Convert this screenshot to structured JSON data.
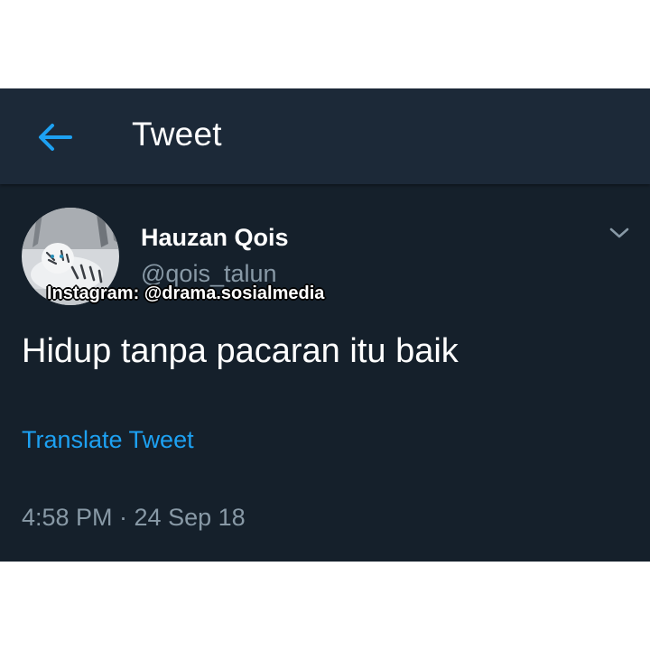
{
  "header": {
    "title": "Tweet",
    "back_icon": "arrow-left-icon"
  },
  "tweet": {
    "author_name": "Hauzan Qois",
    "author_handle": "@qois_talun",
    "text": "Hidup tanpa pacaran itu baik",
    "translate_label": "Translate Tweet",
    "timestamp": "4:58 PM · 24 Sep 18",
    "menu_icon": "chevron-down-icon",
    "avatar_icon": "white-tiger-avatar"
  },
  "watermark": {
    "text": "Instagram: @drama.sosialmedia"
  },
  "colors": {
    "background": "#15202b",
    "header": "#1c2938",
    "accent": "#1da1f2",
    "muted": "#8899a6",
    "text": "#ffffff"
  }
}
